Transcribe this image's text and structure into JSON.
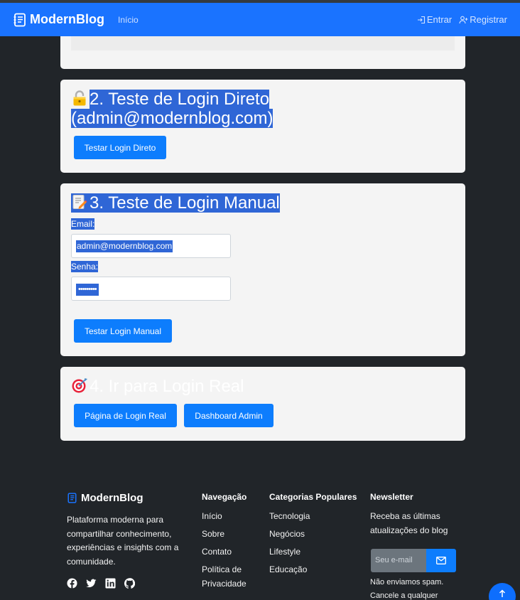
{
  "navbar": {
    "brand": "ModernBlog",
    "home": "Início",
    "login": "Entrar",
    "register": "Registrar"
  },
  "section_direct": {
    "title_line1": "2. Teste de Login Direto",
    "title_line2": "(admin@modernblog.com)",
    "button": "Testar Login Direto"
  },
  "section_manual": {
    "title": "3. Teste de Login Manual",
    "email_label": "Email:",
    "email_value": "admin@modernblog.com",
    "password_label": "Senha:",
    "password_value": "•••••••••",
    "button": "Testar Login Manual"
  },
  "section_real": {
    "title": "4. Ir para Login Real",
    "login_page_button": "Página de Login Real",
    "dashboard_button": "Dashboard Admin"
  },
  "footer": {
    "brand": "ModernBlog",
    "description": "Plataforma moderna para compartilhar conhecimento, experiências e insights com a comunidade.",
    "nav_title": "Navegação",
    "nav_items": [
      "Início",
      "Sobre",
      "Contato",
      "Política de Privacidade"
    ],
    "cat_title": "Categorias Populares",
    "cat_items": [
      "Tecnologia",
      "Negócios",
      "Lifestyle",
      "Educação"
    ],
    "news_title": "Newsletter",
    "news_text": "Receba as últimas atualizações do blog",
    "news_placeholder": "Seu e-mail",
    "news_note": "Não enviamos spam. Cancele a qualquer"
  },
  "colors": {
    "primary": "#1a73ff",
    "button": "#0d7dfd",
    "background": "#212529",
    "card": "#f4f4f4",
    "selection": "#2f66d6"
  },
  "icons": [
    "journal-icon",
    "login-icon",
    "person-add-icon",
    "lock-icon",
    "memo-icon",
    "target-icon",
    "facebook-icon",
    "twitter-icon",
    "linkedin-icon",
    "github-icon",
    "envelope-icon",
    "arrow-up-icon"
  ]
}
